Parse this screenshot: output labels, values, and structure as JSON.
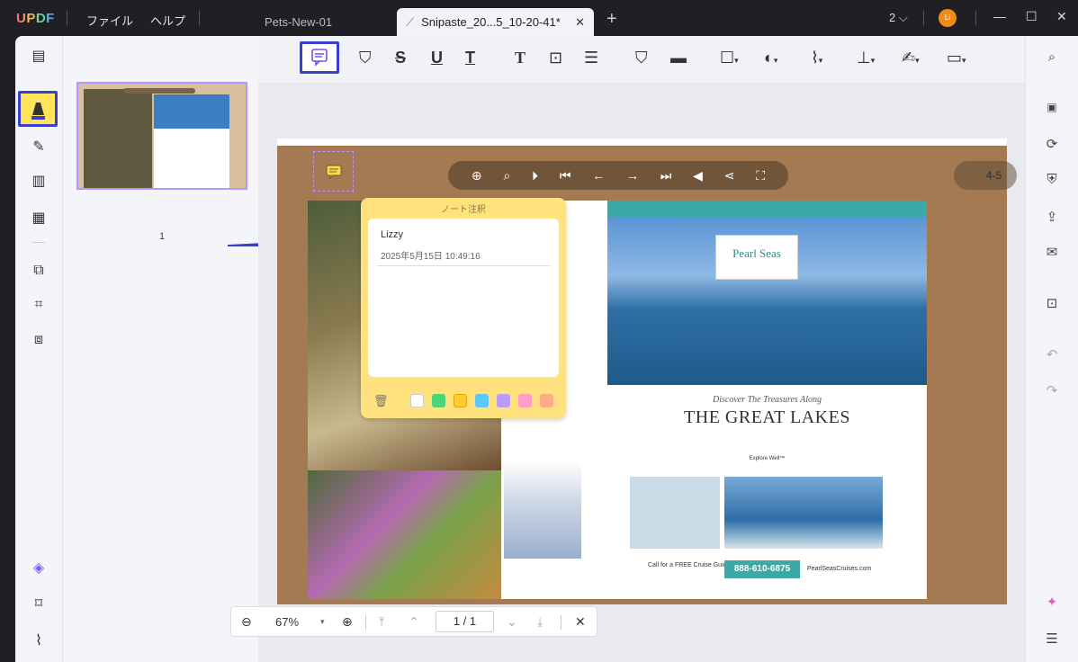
{
  "app": {
    "logo": "UPDF",
    "menu": [
      "ファイル",
      "ヘルプ"
    ],
    "tabs": [
      {
        "label": "Pets-New-01",
        "active": false
      },
      {
        "label": "Snipaste_20...5_10-20-41*",
        "active": true
      }
    ],
    "window_count": "2",
    "avatar_initials": "Li"
  },
  "thumbnail": {
    "page_label": "1"
  },
  "note": {
    "title": "ノート注釈",
    "author": "Lizzy",
    "timestamp": "2025年5月15日 10:49:16",
    "colors": [
      "#ffffff",
      "#4cd47a",
      "#ffcc33",
      "#5bc8f5",
      "#b99cff",
      "#ff9ec4",
      "#ffab8a"
    ]
  },
  "viewer": {
    "page_pill": "4-5"
  },
  "brochure": {
    "logo_text": "Pearl Seas",
    "discover": "Discover The Treasures Along",
    "headline": "THE GREAT LAKES",
    "explore": "Explore Well™",
    "call": "Call for a FREE Cruise Guide",
    "phone": "888-610-6875",
    "site": "PearlSeasCruises.com"
  },
  "bottombar": {
    "zoom": "67%",
    "page": "1 / 1"
  },
  "colors": {
    "accent": "#3b3fd1",
    "note_bg": "#ffe17e",
    "selection": "#b397ff"
  }
}
